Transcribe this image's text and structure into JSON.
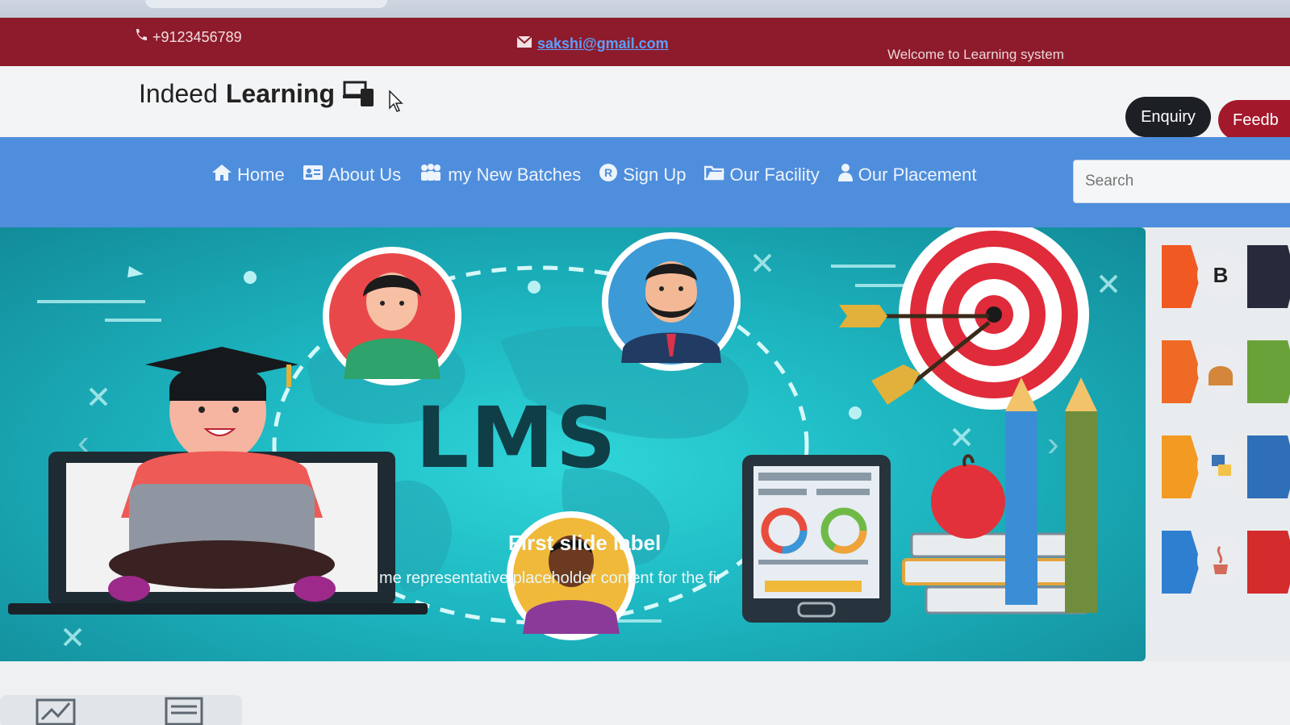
{
  "topbar": {
    "phone": "+9123456789",
    "email": "sakshi@gmail.com",
    "welcome": "Welcome to Learning system"
  },
  "header": {
    "brand_light": "Indeed",
    "brand_strong": "Learning",
    "enquiry_label": "Enquiry",
    "feedback_label": "Feedb"
  },
  "nav": {
    "items": [
      {
        "label": "Home",
        "icon": "home-icon"
      },
      {
        "label": "About Us",
        "icon": "id-card-icon"
      },
      {
        "label": "my New Batches",
        "icon": "users-icon"
      },
      {
        "label": "Sign Up",
        "icon": "registered-icon"
      },
      {
        "label": "Our Facility",
        "icon": "folder-icon"
      },
      {
        "label": "Our Placement",
        "icon": "user-icon"
      }
    ],
    "search_placeholder": "Search"
  },
  "carousel": {
    "title": "LMS",
    "slide_label": "First slide label",
    "slide_caption": "me representative placeholder content for the fir",
    "prev_icon": "chevron-left-icon",
    "next_icon": "chevron-right-icon"
  },
  "side_logos": [
    {
      "name": "bootstrap-logo",
      "text": "B",
      "left": "#f05a22",
      "right": "#262a3a"
    },
    {
      "name": "android-logo",
      "text": "",
      "left": "#ef6a24",
      "right": "#6aa23a"
    },
    {
      "name": "python-logo",
      "text": "",
      "left": "#f39a22",
      "right": "#2f6fb8"
    },
    {
      "name": "java-logo",
      "text": "",
      "left": "#2e7fd0",
      "right": "#d42c2c"
    }
  ],
  "colors": {
    "topbar": "#8e1b2b",
    "navbar": "#4f8edc",
    "carousel": "#1db6c1",
    "enquiry": "#1c1f24",
    "feedback": "#a3182b"
  }
}
